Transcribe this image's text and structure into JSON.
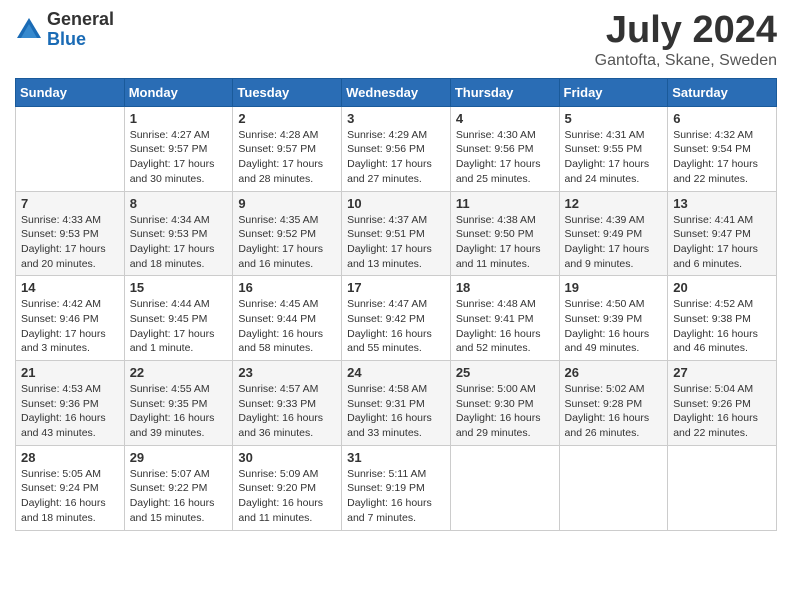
{
  "logo": {
    "general": "General",
    "blue": "Blue"
  },
  "header": {
    "month": "July 2024",
    "location": "Gantofta, Skane, Sweden"
  },
  "days_of_week": [
    "Sunday",
    "Monday",
    "Tuesday",
    "Wednesday",
    "Thursday",
    "Friday",
    "Saturday"
  ],
  "weeks": [
    [
      {
        "day": "",
        "info": ""
      },
      {
        "day": "1",
        "info": "Sunrise: 4:27 AM\nSunset: 9:57 PM\nDaylight: 17 hours and 30 minutes."
      },
      {
        "day": "2",
        "info": "Sunrise: 4:28 AM\nSunset: 9:57 PM\nDaylight: 17 hours and 28 minutes."
      },
      {
        "day": "3",
        "info": "Sunrise: 4:29 AM\nSunset: 9:56 PM\nDaylight: 17 hours and 27 minutes."
      },
      {
        "day": "4",
        "info": "Sunrise: 4:30 AM\nSunset: 9:56 PM\nDaylight: 17 hours and 25 minutes."
      },
      {
        "day": "5",
        "info": "Sunrise: 4:31 AM\nSunset: 9:55 PM\nDaylight: 17 hours and 24 minutes."
      },
      {
        "day": "6",
        "info": "Sunrise: 4:32 AM\nSunset: 9:54 PM\nDaylight: 17 hours and 22 minutes."
      }
    ],
    [
      {
        "day": "7",
        "info": "Sunrise: 4:33 AM\nSunset: 9:53 PM\nDaylight: 17 hours and 20 minutes."
      },
      {
        "day": "8",
        "info": "Sunrise: 4:34 AM\nSunset: 9:53 PM\nDaylight: 17 hours and 18 minutes."
      },
      {
        "day": "9",
        "info": "Sunrise: 4:35 AM\nSunset: 9:52 PM\nDaylight: 17 hours and 16 minutes."
      },
      {
        "day": "10",
        "info": "Sunrise: 4:37 AM\nSunset: 9:51 PM\nDaylight: 17 hours and 13 minutes."
      },
      {
        "day": "11",
        "info": "Sunrise: 4:38 AM\nSunset: 9:50 PM\nDaylight: 17 hours and 11 minutes."
      },
      {
        "day": "12",
        "info": "Sunrise: 4:39 AM\nSunset: 9:49 PM\nDaylight: 17 hours and 9 minutes."
      },
      {
        "day": "13",
        "info": "Sunrise: 4:41 AM\nSunset: 9:47 PM\nDaylight: 17 hours and 6 minutes."
      }
    ],
    [
      {
        "day": "14",
        "info": "Sunrise: 4:42 AM\nSunset: 9:46 PM\nDaylight: 17 hours and 3 minutes."
      },
      {
        "day": "15",
        "info": "Sunrise: 4:44 AM\nSunset: 9:45 PM\nDaylight: 17 hours and 1 minute."
      },
      {
        "day": "16",
        "info": "Sunrise: 4:45 AM\nSunset: 9:44 PM\nDaylight: 16 hours and 58 minutes."
      },
      {
        "day": "17",
        "info": "Sunrise: 4:47 AM\nSunset: 9:42 PM\nDaylight: 16 hours and 55 minutes."
      },
      {
        "day": "18",
        "info": "Sunrise: 4:48 AM\nSunset: 9:41 PM\nDaylight: 16 hours and 52 minutes."
      },
      {
        "day": "19",
        "info": "Sunrise: 4:50 AM\nSunset: 9:39 PM\nDaylight: 16 hours and 49 minutes."
      },
      {
        "day": "20",
        "info": "Sunrise: 4:52 AM\nSunset: 9:38 PM\nDaylight: 16 hours and 46 minutes."
      }
    ],
    [
      {
        "day": "21",
        "info": "Sunrise: 4:53 AM\nSunset: 9:36 PM\nDaylight: 16 hours and 43 minutes."
      },
      {
        "day": "22",
        "info": "Sunrise: 4:55 AM\nSunset: 9:35 PM\nDaylight: 16 hours and 39 minutes."
      },
      {
        "day": "23",
        "info": "Sunrise: 4:57 AM\nSunset: 9:33 PM\nDaylight: 16 hours and 36 minutes."
      },
      {
        "day": "24",
        "info": "Sunrise: 4:58 AM\nSunset: 9:31 PM\nDaylight: 16 hours and 33 minutes."
      },
      {
        "day": "25",
        "info": "Sunrise: 5:00 AM\nSunset: 9:30 PM\nDaylight: 16 hours and 29 minutes."
      },
      {
        "day": "26",
        "info": "Sunrise: 5:02 AM\nSunset: 9:28 PM\nDaylight: 16 hours and 26 minutes."
      },
      {
        "day": "27",
        "info": "Sunrise: 5:04 AM\nSunset: 9:26 PM\nDaylight: 16 hours and 22 minutes."
      }
    ],
    [
      {
        "day": "28",
        "info": "Sunrise: 5:05 AM\nSunset: 9:24 PM\nDaylight: 16 hours and 18 minutes."
      },
      {
        "day": "29",
        "info": "Sunrise: 5:07 AM\nSunset: 9:22 PM\nDaylight: 16 hours and 15 minutes."
      },
      {
        "day": "30",
        "info": "Sunrise: 5:09 AM\nSunset: 9:20 PM\nDaylight: 16 hours and 11 minutes."
      },
      {
        "day": "31",
        "info": "Sunrise: 5:11 AM\nSunset: 9:19 PM\nDaylight: 16 hours and 7 minutes."
      },
      {
        "day": "",
        "info": ""
      },
      {
        "day": "",
        "info": ""
      },
      {
        "day": "",
        "info": ""
      }
    ]
  ]
}
